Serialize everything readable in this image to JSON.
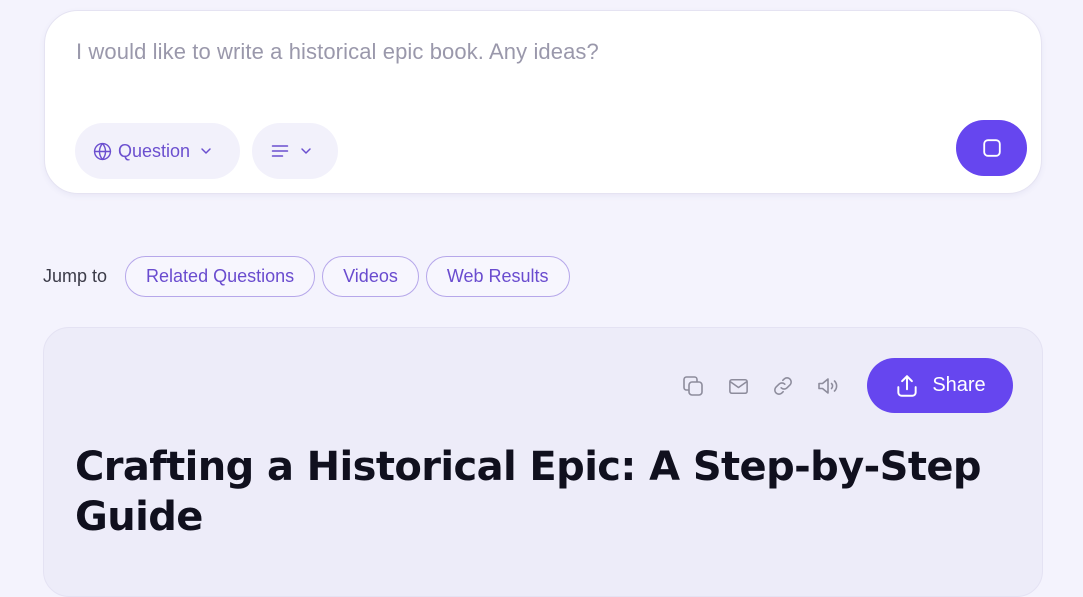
{
  "search": {
    "query": "I would like to write a historical epic book. Any ideas?",
    "mode_label": "Question",
    "mode_icon": "globe-icon",
    "format_icon": "text-lines-icon",
    "send_icon": "stop-square-icon"
  },
  "jump_to": {
    "label": "Jump to",
    "links": [
      {
        "label": "Related Questions"
      },
      {
        "label": "Videos"
      },
      {
        "label": "Web Results"
      }
    ]
  },
  "answer": {
    "toolbar": {
      "icons": [
        "copy-icon",
        "mail-icon",
        "link-icon",
        "speaker-icon"
      ],
      "share_label": "Share",
      "share_icon": "upload-share-icon"
    },
    "title": "Crafting a Historical Epic: A Step-by-Step Guide"
  },
  "colors": {
    "accent": "#6646ef",
    "accent_text": "#6b4fcf",
    "background": "#f4f3fd",
    "card": "#ffffff",
    "answer_card": "#edecf9",
    "title_text": "#10101e",
    "placeholder_text": "#9a98ab"
  }
}
